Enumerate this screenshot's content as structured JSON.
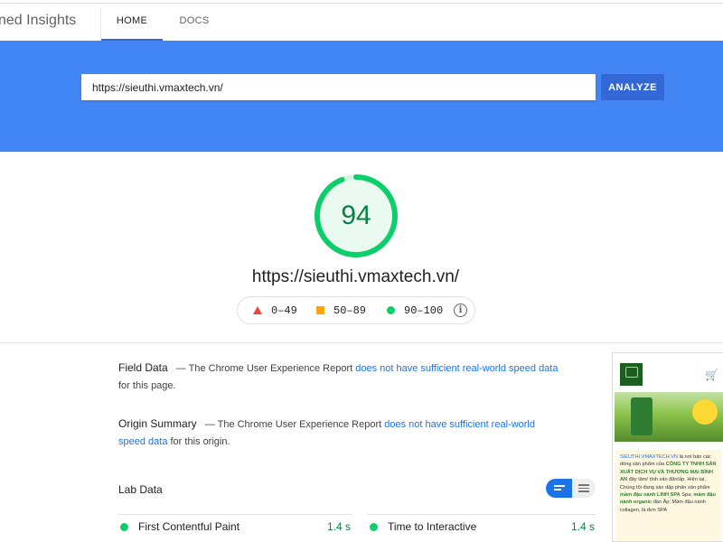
{
  "header": {
    "brand": "ned Insights",
    "tabs": [
      {
        "label": "HOME",
        "active": true
      },
      {
        "label": "DOCS",
        "active": false
      }
    ]
  },
  "search": {
    "value": "https://sieuthi.vmaxtech.vn/",
    "analyze_label": "ANALYZE"
  },
  "report": {
    "score": "94",
    "score_fraction": 0.94,
    "url": "https://sieuthi.vmaxtech.vn/",
    "legend": [
      {
        "range": "0–49",
        "color": "#f44336",
        "shape": "triangle"
      },
      {
        "range": "50–89",
        "color": "#ffa400",
        "shape": "square"
      },
      {
        "range": "90–100",
        "color": "#0cce6b",
        "shape": "circle"
      }
    ],
    "legend_info_icon": "info-icon"
  },
  "field_data": {
    "title": "Field Data",
    "prefix": "— The Chrome User Experience Report",
    "link": "does not have sufficient real-world speed data",
    "suffix": "for this page."
  },
  "origin_summary": {
    "title": "Origin Summary",
    "prefix": "— The Chrome User Experience Report",
    "link": "does not have sufficient real-world speed data",
    "suffix": "for this origin."
  },
  "lab_data": {
    "title": "Lab Data",
    "metrics": [
      {
        "name": "First Contentful Paint",
        "value": "1.4 s"
      },
      {
        "name": "Time to Interactive",
        "value": "1.4 s"
      }
    ]
  },
  "thumbnail": {
    "text": {
      "site": "SIEUTHI.VMAXTECH.VN",
      "l1": "là nơi bán các dòng sản phẩm của",
      "company": "CÔNG TY TNHH SẢN XUẤT DỊCH VỤ VÀ THƯƠNG MẠI BÌNH AN",
      "l2": "đây tâm/ tính sản đãn/ấp.",
      "l3": "Hiện tại, Chúng tôi đang sản dập phân sản phẩm",
      "p1": "mầm đậu nành LINH SPA",
      "l4": "Spa;",
      "p2": "mầm đậu nành organic",
      "l5": "đàn Ấp; Mầm đậu nành collagen, là đơn SPA"
    }
  },
  "colors": {
    "accent_blue": "#4285f4",
    "button_blue": "#3367d6",
    "pass_green": "#0cce6b",
    "score_text": "#0b8043"
  }
}
